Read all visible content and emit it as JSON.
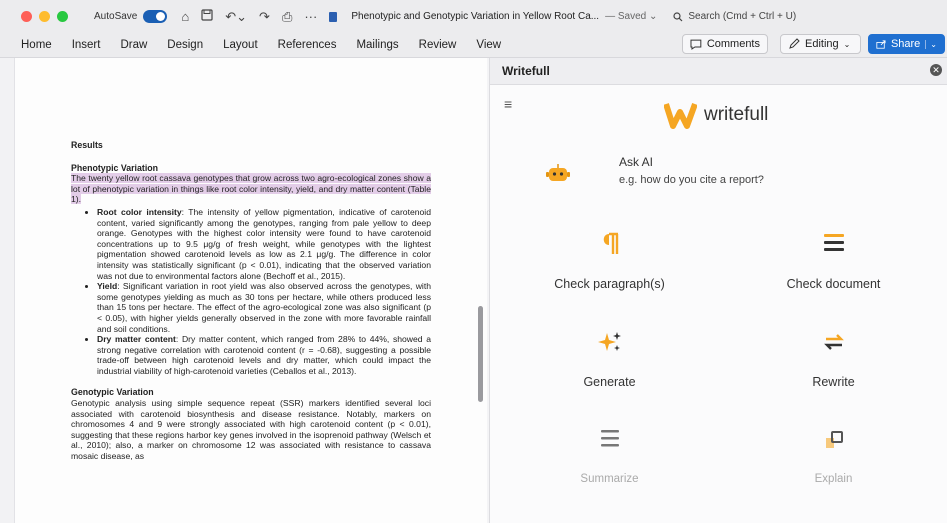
{
  "titlebar": {
    "autosave_label": "AutoSave",
    "document_title": "Phenotypic and Genotypic Variation in Yellow Root Ca...",
    "saved_status": "— Saved ⌄",
    "search_label": "Search (Cmd + Ctrl + U)"
  },
  "ribbon": {
    "tabs": [
      "Home",
      "Insert",
      "Draw",
      "Design",
      "Layout",
      "References",
      "Mailings",
      "Review",
      "View"
    ],
    "comments_label": "Comments",
    "editing_label": "Editing",
    "share_label": "Share"
  },
  "document": {
    "results_heading": "Results",
    "phenotypic_heading": "Phenotypic Variation",
    "phenotypic_intro": "The twenty yellow root cassava genotypes that grow across two agro-ecological zones show a lot of phenotypic variation in things like root color intensity, yield, and dry matter content (Table 1).",
    "bullets": [
      {
        "term": "Root color intensity",
        "text": ": The intensity of yellow pigmentation, indicative of carotenoid content, varied significantly among the genotypes, ranging from pale yellow to deep orange. Genotypes with the highest color intensity were found to have carotenoid concentrations up to 9.5 μg/g of fresh weight, while genotypes with the lightest pigmentation showed carotenoid levels as low as 2.1 μg/g. The difference in color intensity was statistically significant (p < 0.01), indicating that the observed variation was not due to environmental factors alone (Bechoff et al., 2015)."
      },
      {
        "term": "Yield",
        "text": ": Significant variation in root yield was also observed across the genotypes, with some genotypes yielding as much as 30 tons per hectare, while others produced less than 15 tons per hectare. The effect of the agro-ecological zone was also significant (p < 0.05), with higher yields generally observed in the zone with more favorable rainfall and soil conditions."
      },
      {
        "term": "Dry matter content",
        "text": ": Dry matter content, which ranged from 28% to 44%, showed a strong negative correlation with carotenoid content (r = -0.68), suggesting a possible trade-off between high carotenoid levels and dry matter, which could impact the industrial viability of high-carotenoid varieties (Ceballos et al., 2013)."
      }
    ],
    "genotypic_heading": "Genotypic Variation",
    "genotypic_text": "Genotypic analysis using simple sequence repeat (SSR) markers identified several loci associated with carotenoid biosynthesis and disease resistance. Notably, markers on chromosomes 4 and 9 were strongly associated with high carotenoid content (p < 0.01), suggesting that these regions harbor key genes involved in the isoprenoid pathway (Welsch et al., 2010); also, a marker on chromosome 12 was associated with resistance to cassava mosaic disease, as"
  },
  "panel": {
    "title": "Writefull",
    "logo_text": "writefull",
    "ask_ai_label": "Ask AI",
    "ask_ai_placeholder": "e.g. how do you cite a report?",
    "actions": [
      {
        "label": "Check paragraph(s)",
        "icon": "paragraph-icon",
        "enabled": true
      },
      {
        "label": "Check document",
        "icon": "document-lines-icon",
        "enabled": true
      },
      {
        "label": "Generate",
        "icon": "sparkle-icon",
        "enabled": true
      },
      {
        "label": "Rewrite",
        "icon": "rewrite-arrows-icon",
        "enabled": true
      },
      {
        "label": "Summarize",
        "icon": "summarize-lines-icon",
        "enabled": false
      },
      {
        "label": "Explain",
        "icon": "explain-icon",
        "enabled": false
      }
    ],
    "accent_color": "#f5a623"
  }
}
